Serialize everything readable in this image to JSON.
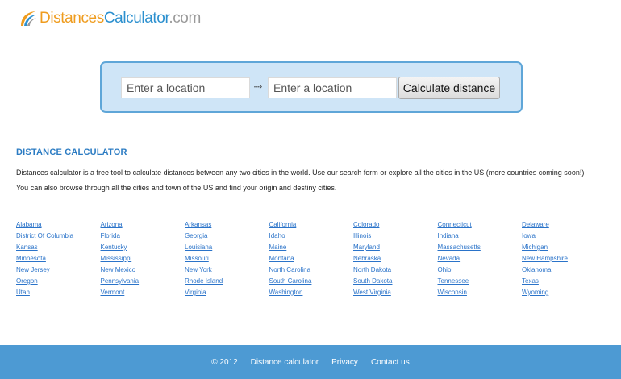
{
  "logo": {
    "part1": "Distances",
    "part2": "Calculator",
    "part3": ".com"
  },
  "search": {
    "from_placeholder": "Enter a location",
    "to_placeholder": "Enter a location",
    "arrow": "⤑",
    "button_label": "Calculate distance"
  },
  "content": {
    "title": "DISTANCE CALCULATOR",
    "paragraph1": "Distances calculator is a free tool to calculate distances between any two cities in the world. Use our search form or explore all the cities in the US (more countries coming soon!)",
    "paragraph2": "You can also browse through all the cities and town of the US and find your origin and destiny cities."
  },
  "states": [
    "Alabama",
    "Arizona",
    "Arkansas",
    "California",
    "Colorado",
    "Connecticut",
    "Delaware",
    "District Of Columbia",
    "Florida",
    "Georgia",
    "Idaho",
    "Illinois",
    "Indiana",
    "Iowa",
    "Kansas",
    "Kentucky",
    "Louisiana",
    "Maine",
    "Maryland",
    "Massachusetts",
    "Michigan",
    "Minnesota",
    "Mississippi",
    "Missouri",
    "Montana",
    "Nebraska",
    "Nevada",
    "New Hampshire",
    "New Jersey",
    "New Mexico",
    "New York",
    "North Carolina",
    "North Dakota",
    "Ohio",
    "Oklahoma",
    "Oregon",
    "Pennsylvania",
    "Rhode Island",
    "South Carolina",
    "South Dakota",
    "Tennessee",
    "Texas",
    "Utah",
    "Vermont",
    "Virginia",
    "Washington",
    "West Virginia",
    "Wisconsin",
    "Wyoming"
  ],
  "footer": {
    "copyright": "© 2012",
    "site_link": "Distance calculator",
    "privacy_link": "Privacy",
    "contact_link": "Contact us"
  },
  "colors": {
    "accent_orange": "#ef9c1e",
    "accent_blue": "#2c90cf",
    "search_bg": "#cfe5f7",
    "footer_bg": "#4d9ad3",
    "link": "#2a73c9"
  },
  "icons": {
    "logo_mark": "swoosh-logo-icon",
    "arrow": "right-arrow-icon"
  }
}
